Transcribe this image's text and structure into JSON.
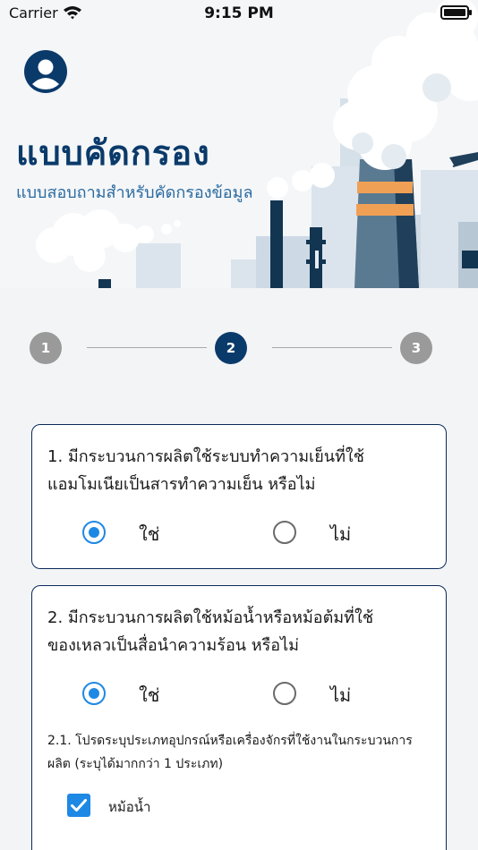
{
  "status_bar": {
    "carrier": "Carrier",
    "time": "9:15 PM"
  },
  "header": {
    "title": "แบบคัดกรอง",
    "subtitle": "แบบสอบถามสำหรับคัดกรองข้อมูล"
  },
  "stepper": {
    "steps": [
      "1",
      "2",
      "3"
    ],
    "active_step": 2
  },
  "questions": [
    {
      "text": "1. มีกระบวนการผลิตใช้ระบบทำความเย็นที่ใช้แอมโมเนียเป็นสารทำความเย็น หรือไม่",
      "options": {
        "yes": "ใช่",
        "no": "ไม่"
      },
      "selected": "yes"
    },
    {
      "text": "2. มีกระบวนการผลิตใช้หม้อน้ำหรือหม้อต้มที่ใช้ของเหลวเป็นสื่อนำความร้อน หรือไม่",
      "options": {
        "yes": "ใช่",
        "no": "ไม่"
      },
      "selected": "yes",
      "sub_question": {
        "text": "2.1. โปรดระบุประเภทอุปกรณ์หรือเครื่องจักรที่ใช้งานในกระบวนการผลิต (ระบุได้มากกว่า 1 ประเภท)",
        "options": [
          {
            "label": "หม้อน้ำ",
            "checked": true
          }
        ]
      }
    }
  ],
  "colors": {
    "primary": "#0a3a6a",
    "accent": "#1e88e5",
    "stack_stripe": "#f0a055"
  },
  "icons": {
    "avatar": "user-avatar-icon",
    "wifi": "wifi-icon",
    "battery": "battery-icon"
  }
}
